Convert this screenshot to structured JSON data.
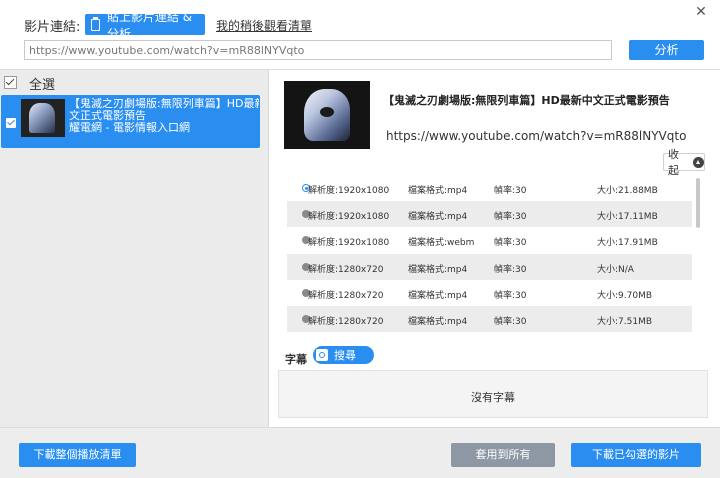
{
  "header": {
    "url_label": "影片連結:",
    "paste_button": "貼上影片連結 & 分析",
    "watch_later": "我的稍後觀看清單",
    "url_value": "https://www.youtube.com/watch?v=mR88lNYVqto",
    "analyze_button": "分析",
    "close_glyph": "✕"
  },
  "left_panel": {
    "select_all": "全選",
    "items": [
      {
        "line1": "【鬼滅之刃劇場版:無限列車篇】HD最新中",
        "line2": "文正式電影預告",
        "line3": "耀電網 - 電影情報入口網"
      }
    ]
  },
  "video": {
    "title": "【鬼滅之刃劇場版:無限列車篇】HD最新中文正式電影預告",
    "url": "https://www.youtube.com/watch?v=mR88lNYVqto",
    "collapse_button": "收起"
  },
  "formats": [
    {
      "resolution": "解析度:1920x1080",
      "format": "檔案格式:mp4",
      "fps": "幀率:30",
      "size": "大小:21.88MB",
      "selected": true
    },
    {
      "resolution": "解析度:1920x1080",
      "format": "檔案格式:mp4",
      "fps": "幀率:30",
      "size": "大小:17.11MB",
      "selected": false
    },
    {
      "resolution": "解析度:1920x1080",
      "format": "檔案格式:webm",
      "fps": "幀率:30",
      "size": "大小:17.91MB",
      "selected": false
    },
    {
      "resolution": "解析度:1280x720",
      "format": "檔案格式:mp4",
      "fps": "幀率:30",
      "size": "大小:N/A",
      "selected": false
    },
    {
      "resolution": "解析度:1280x720",
      "format": "檔案格式:mp4",
      "fps": "幀率:30",
      "size": "大小:9.70MB",
      "selected": false
    },
    {
      "resolution": "解析度:1280x720",
      "format": "檔案格式:mp4",
      "fps": "幀率:30",
      "size": "大小:7.51MB",
      "selected": false
    }
  ],
  "subtitles": {
    "label": "字幕",
    "search_button": "搜尋",
    "empty_text": "沒有字幕"
  },
  "footer": {
    "download_playlist": "下載整個播放清單",
    "apply_all": "套用到所有",
    "download_selected": "下載已勾選的影片"
  },
  "colors": {
    "accent": "#2a8ef1",
    "disabled_button": "#8e97a4",
    "left_panel_bg": "#ebebeb"
  }
}
